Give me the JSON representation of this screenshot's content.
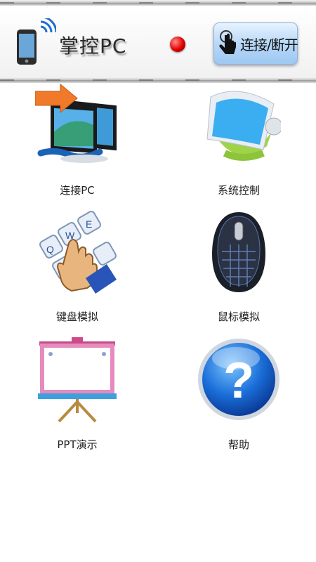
{
  "header": {
    "app_title": "掌控PC",
    "connect_button_label": "连接/断开",
    "status_color": "#e10000"
  },
  "menu": {
    "items": [
      {
        "label": "连接PC",
        "icon": "monitors-connect-icon"
      },
      {
        "label": "系统控制",
        "icon": "computer-control-icon"
      },
      {
        "label": "键盘模拟",
        "icon": "keyboard-icon"
      },
      {
        "label": "鼠标模拟",
        "icon": "mouse-icon"
      },
      {
        "label": "PPT演示",
        "icon": "presentation-board-icon"
      },
      {
        "label": "帮助",
        "icon": "help-icon"
      }
    ]
  }
}
